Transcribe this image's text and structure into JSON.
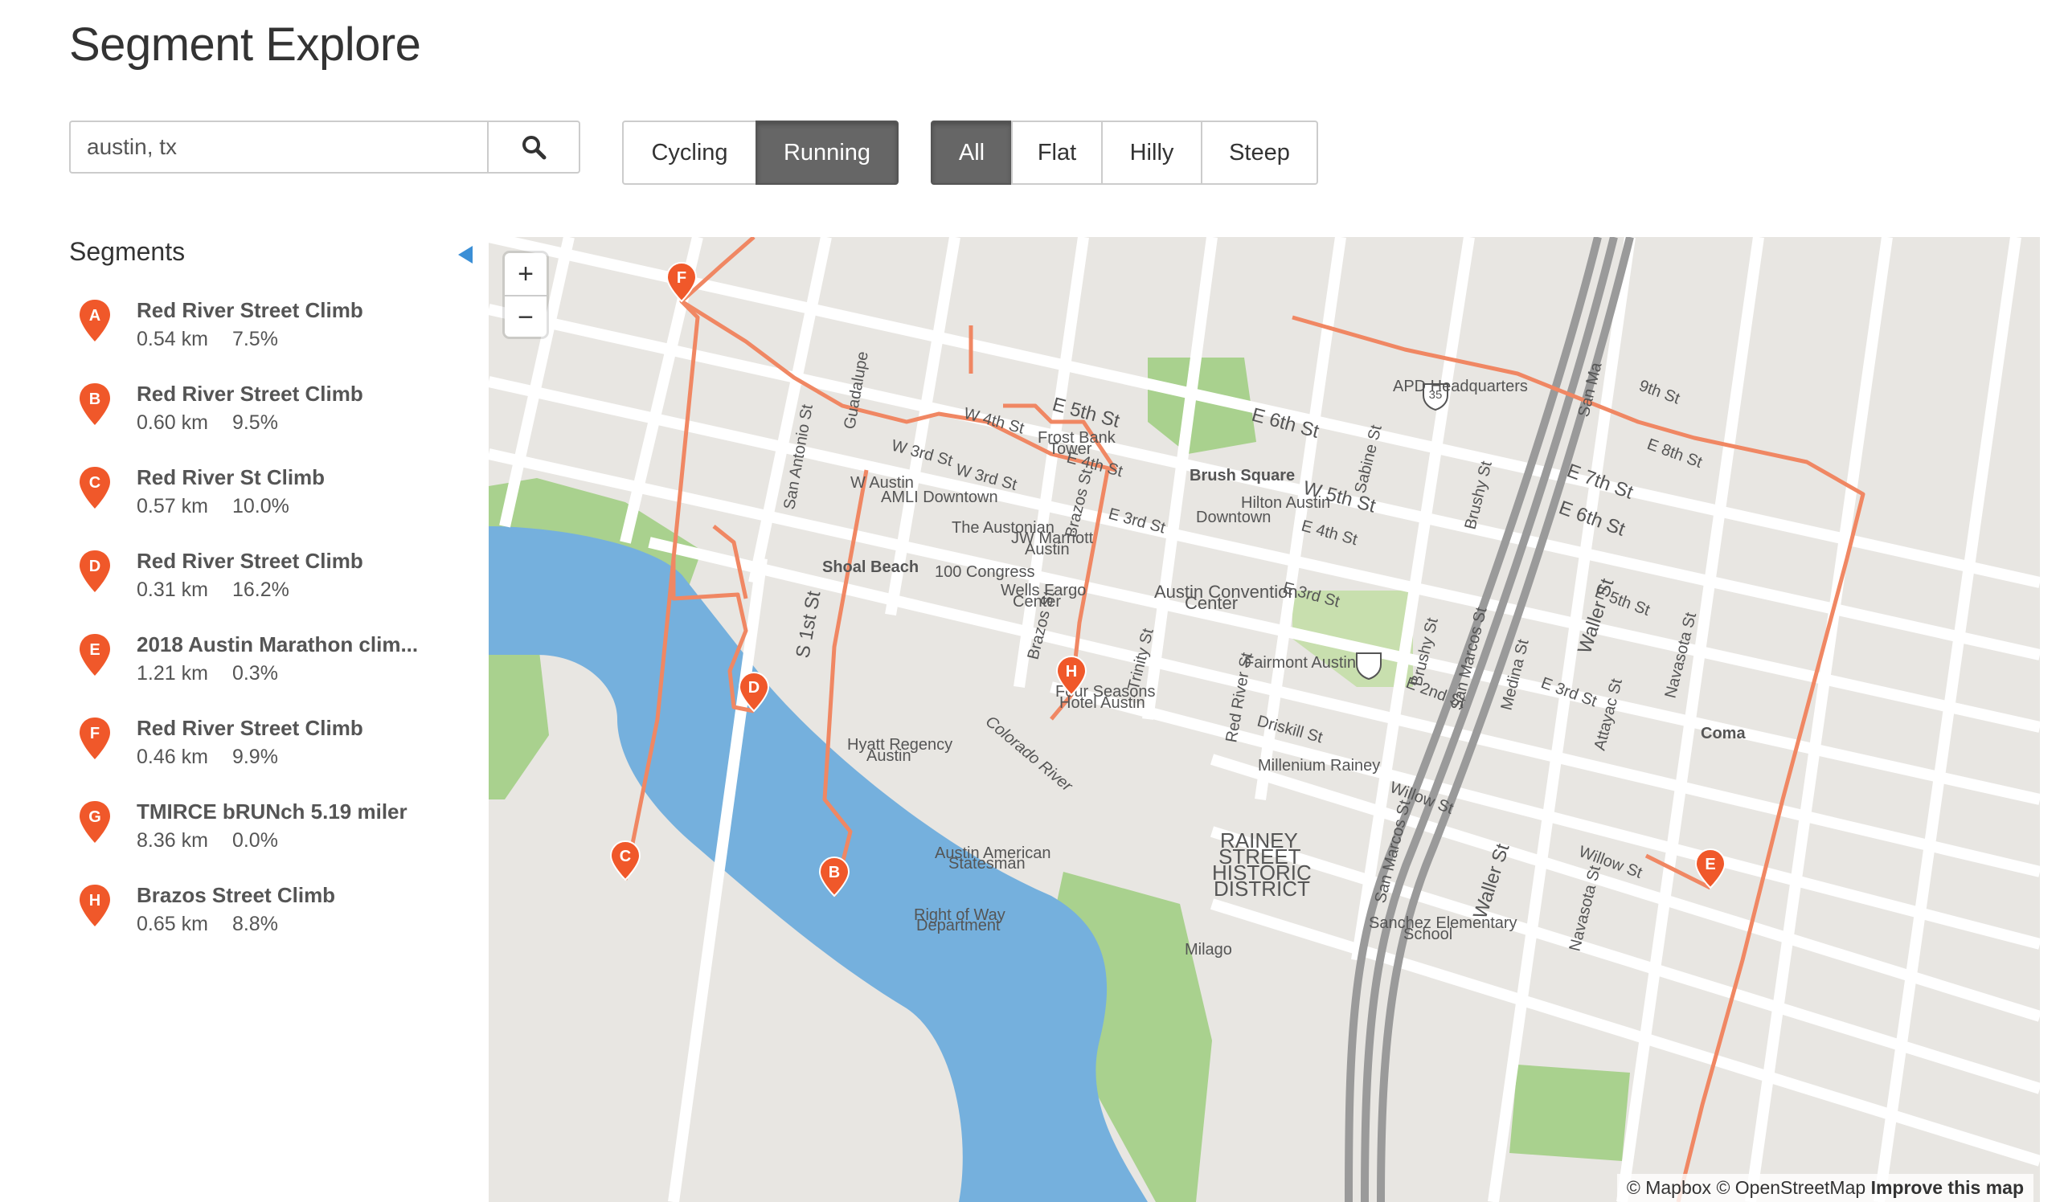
{
  "page": {
    "title": "Segment Explore"
  },
  "search": {
    "value": "austin, tx",
    "icon": "search-icon"
  },
  "sport_toggle": [
    {
      "label": "Cycling",
      "active": false
    },
    {
      "label": "Running",
      "active": true
    }
  ],
  "terrain_filter": [
    {
      "label": "All",
      "active": true
    },
    {
      "label": "Flat",
      "active": false
    },
    {
      "label": "Hilly",
      "active": false
    },
    {
      "label": "Steep",
      "active": false
    }
  ],
  "sidebar": {
    "title": "Segments",
    "collapse_icon": "triangle-left-icon",
    "segments": [
      {
        "marker": "A",
        "name": "Red River Street Climb",
        "distance": "0.54 km",
        "grade": "7.5%"
      },
      {
        "marker": "B",
        "name": "Red River Street Climb",
        "distance": "0.60 km",
        "grade": "9.5%"
      },
      {
        "marker": "C",
        "name": "Red River St Climb",
        "distance": "0.57 km",
        "grade": "10.0%"
      },
      {
        "marker": "D",
        "name": "Red River Street Climb",
        "distance": "0.31 km",
        "grade": "16.2%"
      },
      {
        "marker": "E",
        "name": "2018 Austin Marathon clim...",
        "distance": "1.21 km",
        "grade": "0.3%"
      },
      {
        "marker": "F",
        "name": "Red River Street Climb",
        "distance": "0.46 km",
        "grade": "9.9%"
      },
      {
        "marker": "G",
        "name": "TMIRCE bRUNch 5.19 miler",
        "distance": "8.36 km",
        "grade": "0.0%"
      },
      {
        "marker": "H",
        "name": "Brazos Street Climb",
        "distance": "0.65 km",
        "grade": "8.8%"
      }
    ]
  },
  "map": {
    "zoom_in": "+",
    "zoom_out": "−",
    "attribution": {
      "mapbox": "© Mapbox",
      "osm": "© OpenStreetMap",
      "improve": "Improve this map"
    },
    "colors": {
      "marker": "#f0582a",
      "route": "#f08763",
      "water": "#75b0dd",
      "park": "#a9d18e",
      "land": "#e8e6e2"
    },
    "labels": {
      "apd": "APD Headquarters",
      "e6": "E 6th St",
      "e5": "E 5th St",
      "w4": "W 4th St",
      "w3": "W 3rd St",
      "w3b": "W 3rd St",
      "e4": "E 4th St",
      "e3": "E 3rd St",
      "frost": "Frost Bank",
      "frost2": "Tower",
      "brush": "Brush Square",
      "hilton": "Hilton Austin",
      "downtown": "Downtown",
      "waustin": "W Austin",
      "amli": "AMLI Downtown",
      "austonian": "The Austonian",
      "marriott": "JW Marriott",
      "marriott2": "Austin",
      "congress": "100 Congress",
      "wells": "Wells Fargo",
      "wells2": "Center",
      "shoal": "Shoal Beach",
      "conv": "Austin Convention",
      "conv2": "Center",
      "fairmont": "Fairmont Austin",
      "seasons": "Four Seasons",
      "seasons2": "Hotel Austin",
      "hyatt": "Hyatt Regency",
      "hyatt2": "Austin",
      "colorado": "Colorado River",
      "driskill": "Driskill St",
      "millenium": "Millenium Rainey",
      "rainey1": "RAINEY",
      "rainey2": "STREET",
      "rainey3": "HISTORIC",
      "rainey4": "DISTRICT",
      "statesman": "Austin American",
      "statesman2": "Statesman",
      "row": "Right of Way",
      "row2": "Department",
      "milago": "Milago",
      "sanchez": "Sanchez Elementary",
      "sanchez2": "School",
      "e8": "E 8th St",
      "e7": "E 7th St",
      "e6b": "E 6th St",
      "e5b": "E 5th St",
      "e2": "E 2nd St",
      "e3b": "E 3rd St",
      "willow": "Willow St",
      "willow2": "Willow St",
      "waller": "Waller St",
      "waller2": "Waller St",
      "guadalupe": "Guadalupe",
      "sanantonio": "San Antonio St",
      "s1st": "S 1st St",
      "brazos": "Brazos St",
      "brazos2": "Brazos St",
      "trinity": "Trinity St",
      "redriver": "Red River St",
      "sabine": "Sabine St",
      "brushy": "Brushy St",
      "brushy2": "Brushy St",
      "sanmarcos": "San Marcos St",
      "sanmarcos2": "San Marcos St",
      "medina": "Medina St",
      "attayac": "Attayac St",
      "navasota": "Navasota St",
      "navasota2": "Navasota St",
      "sanmarcos3": "San Ma",
      "coma": "Coma",
      "i35": "35",
      "e9": "9th St",
      "w5": "W 5th St",
      "east": "E"
    }
  }
}
